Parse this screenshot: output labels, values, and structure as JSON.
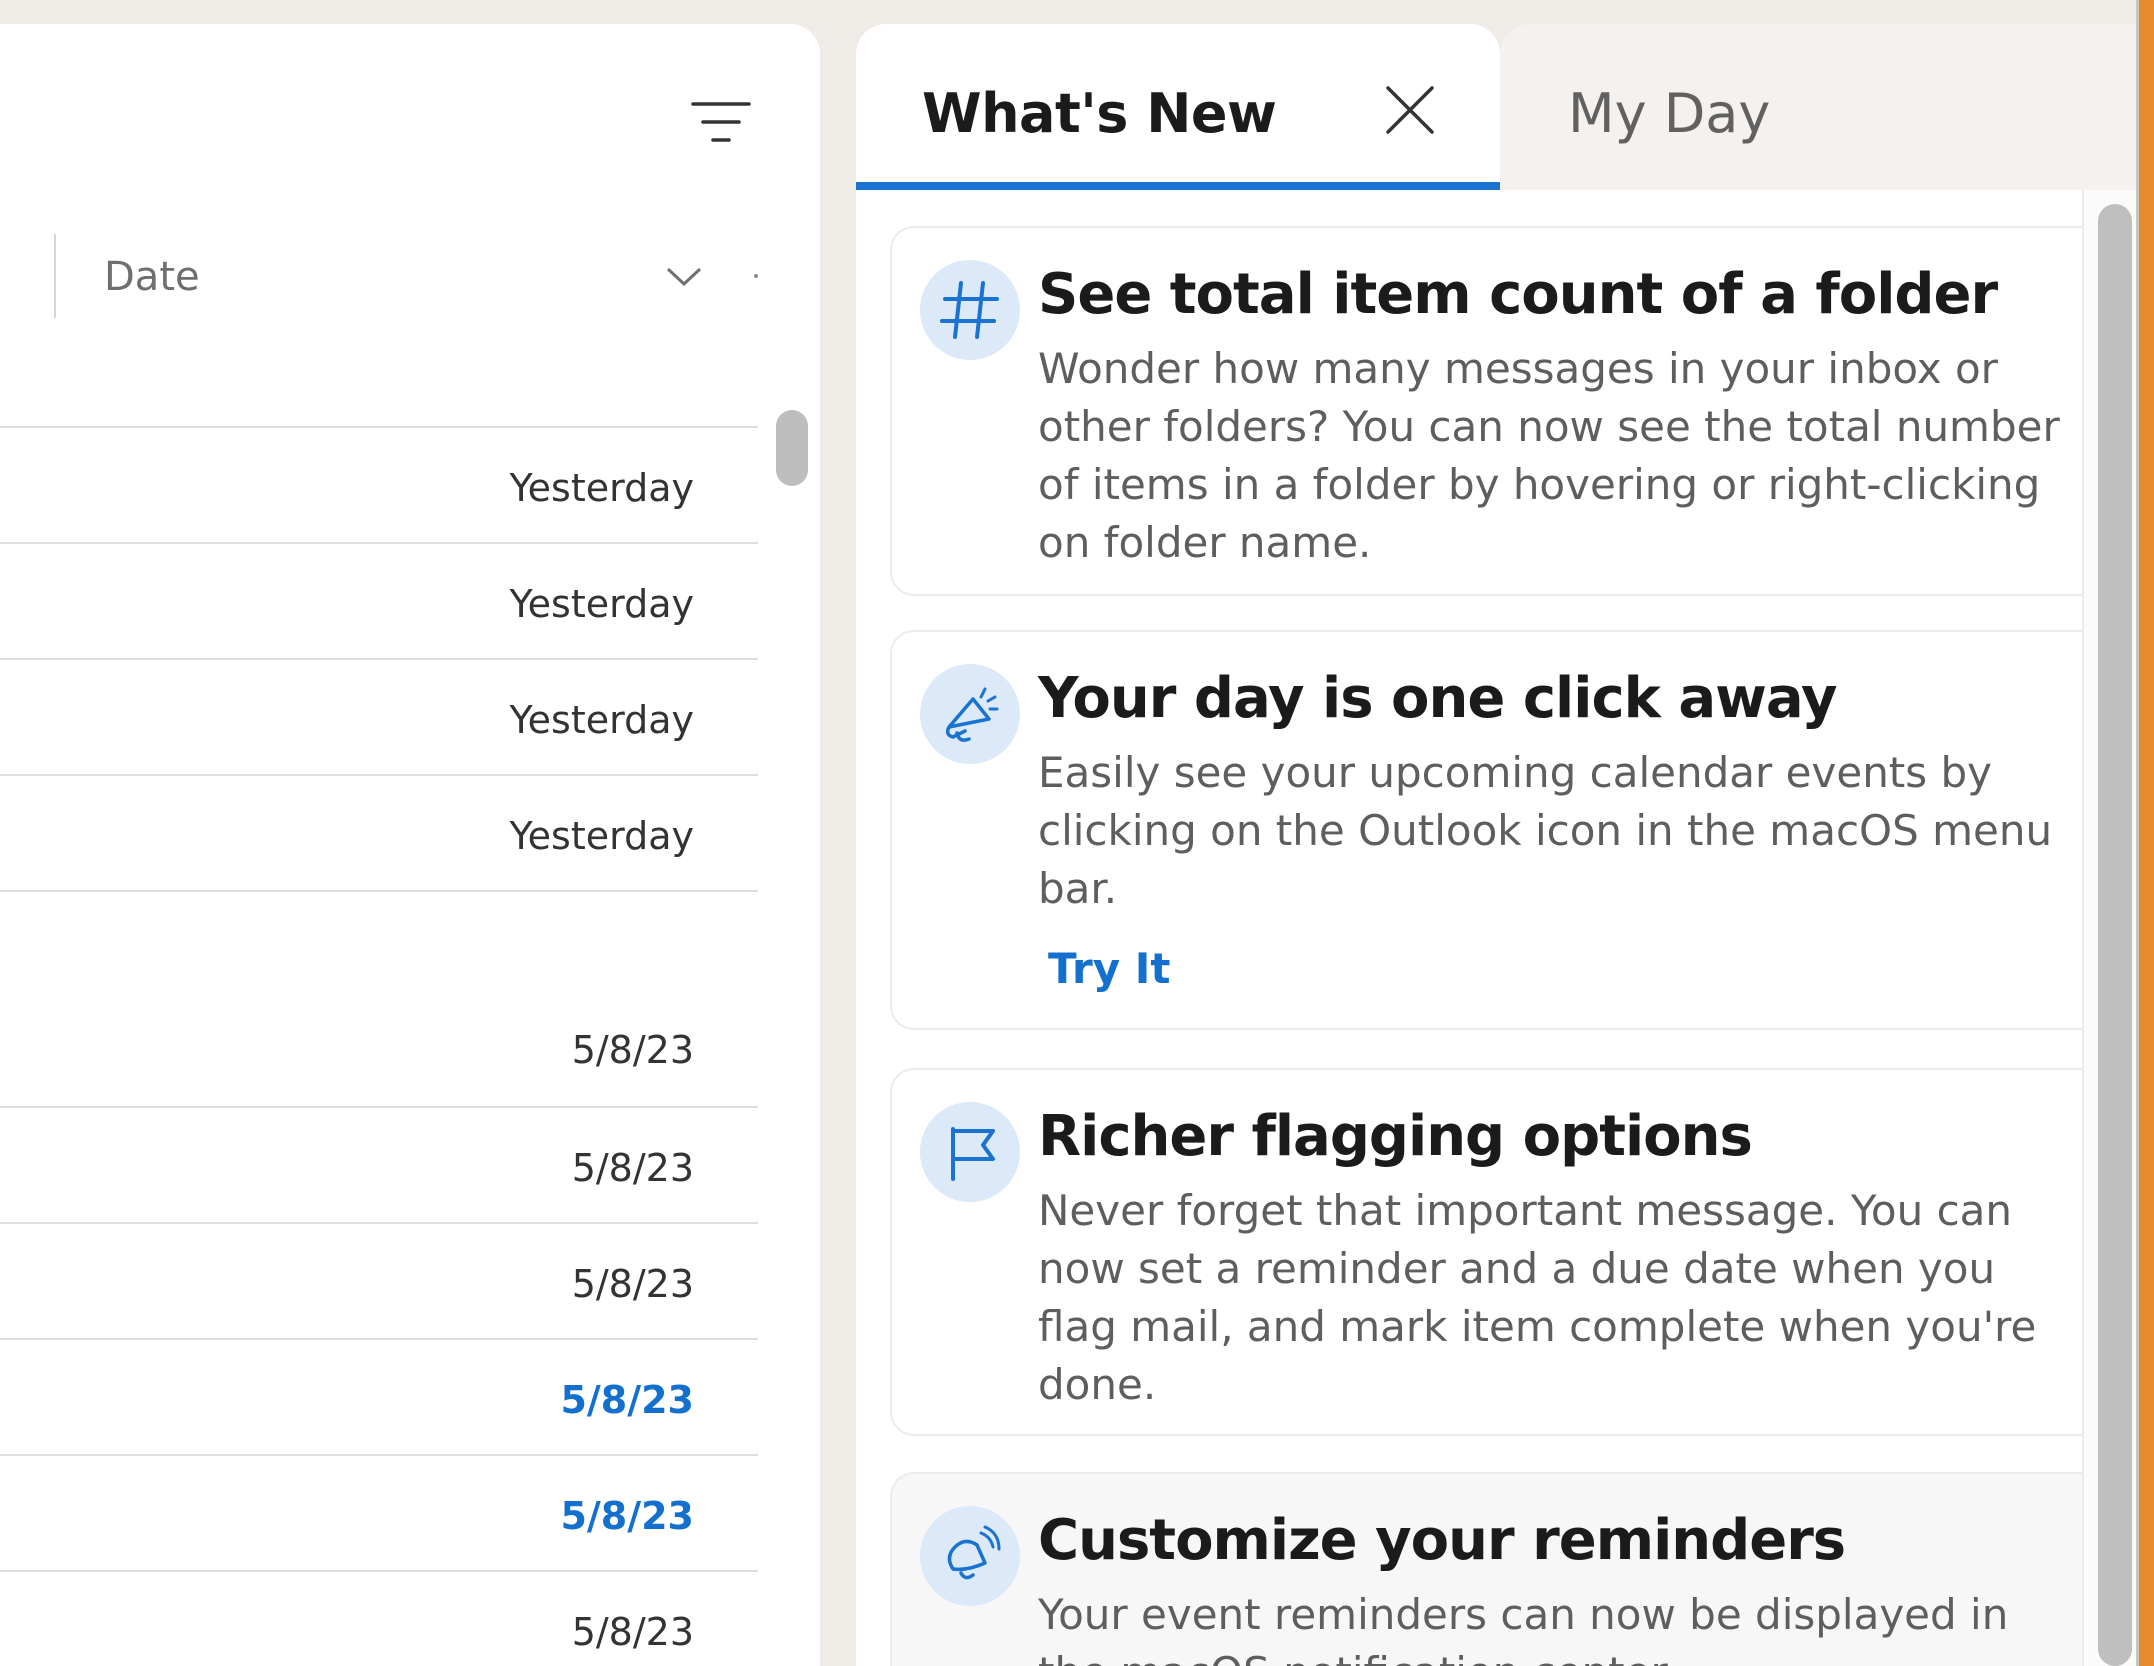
{
  "message_list": {
    "sort": {
      "label": "Date"
    },
    "rows": [
      {
        "date": "Yesterday",
        "unread": false
      },
      {
        "date": "Yesterday",
        "unread": false
      },
      {
        "date": "Yesterday",
        "unread": false
      },
      {
        "date": "Yesterday",
        "unread": false
      },
      {
        "date": "5/8/23",
        "unread": false
      },
      {
        "date": "5/8/23",
        "unread": false
      },
      {
        "date": "5/8/23",
        "unread": false
      },
      {
        "date": "5/8/23",
        "unread": true
      },
      {
        "date": "5/8/23",
        "unread": true
      },
      {
        "date": "5/8/23",
        "unread": false
      }
    ]
  },
  "tabs": {
    "active": {
      "label": "What's New"
    },
    "inactive": {
      "label": "My Day"
    }
  },
  "whats_new": {
    "cards": [
      {
        "icon": "hash-icon",
        "title": "See total item count of a folder",
        "body": "Wonder how many messages in your inbox or other folders? You can now see the total number of items in a folder by hovering or right-clicking on folder name."
      },
      {
        "icon": "megaphone-icon",
        "title": "Your day is one click away",
        "body": "Easily see your upcoming calendar events by clicking on the Outlook icon in the macOS menu bar.",
        "link": "Try It"
      },
      {
        "icon": "flag-icon",
        "title": "Richer flagging options",
        "body": "Never forget that important message. You can now set a reminder and a due date when you flag mail, and mark item complete when you're done."
      },
      {
        "icon": "bell-ringing-icon",
        "title": "Customize your reminders",
        "body": "Your event reminders can now be displayed in the macOS notification center."
      }
    ]
  },
  "colors": {
    "accent": "#1a73d1",
    "unread_date": "#1470cf",
    "icon_circle": "#dce9f8"
  }
}
